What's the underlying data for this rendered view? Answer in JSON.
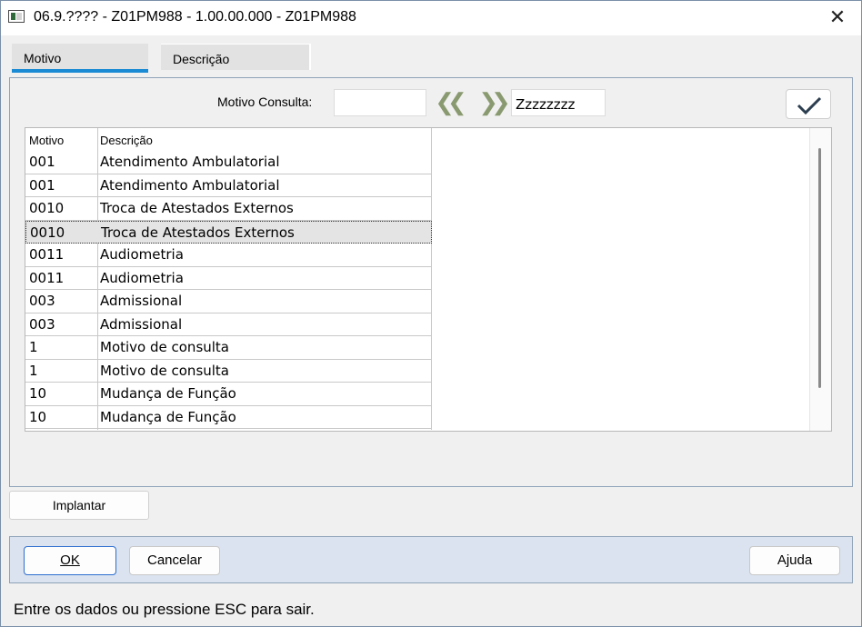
{
  "window": {
    "title": "06.9.???? - Z01PM988 - 1.00.00.000 - Z01PM988",
    "close_glyph": "✕"
  },
  "tabs": [
    {
      "label": "Motivo",
      "active": true
    },
    {
      "label": "Descrição",
      "active": false
    }
  ],
  "search": {
    "label": "Motivo Consulta:",
    "from_value": "",
    "to_value": "Zzzzzzzz",
    "prev_glyph": "❮❮",
    "next_glyph": "❯❯"
  },
  "grid": {
    "columns": [
      "Motivo",
      "Descrição"
    ],
    "rows": [
      {
        "motivo": "001",
        "descricao": "Atendimento Ambulatorial",
        "selected": false
      },
      {
        "motivo": "001",
        "descricao": "Atendimento Ambulatorial",
        "selected": false
      },
      {
        "motivo": "0010",
        "descricao": "Troca de Atestados Externos",
        "selected": false
      },
      {
        "motivo": "0010",
        "descricao": "Troca de Atestados Externos",
        "selected": true
      },
      {
        "motivo": "0011",
        "descricao": "Audiometria",
        "selected": false
      },
      {
        "motivo": "0011",
        "descricao": "Audiometria",
        "selected": false
      },
      {
        "motivo": "003",
        "descricao": "Admissional",
        "selected": false
      },
      {
        "motivo": "003",
        "descricao": "Admissional",
        "selected": false
      },
      {
        "motivo": "1",
        "descricao": "Motivo de consulta",
        "selected": false
      },
      {
        "motivo": "1",
        "descricao": "Motivo de consulta",
        "selected": false
      },
      {
        "motivo": "10",
        "descricao": "Mudança de Função",
        "selected": false
      },
      {
        "motivo": "10",
        "descricao": "Mudança de Função",
        "selected": false
      }
    ]
  },
  "buttons": {
    "implantar": "Implantar",
    "ok": "OK",
    "cancelar": "Cancelar",
    "ajuda": "Ajuda"
  },
  "status_text": "Entre os dados ou pressione ESC para sair.",
  "colors": {
    "accent": "#1a8ad4",
    "footer_bg": "#dae3ef",
    "window_bg": "#f0f0f0"
  }
}
